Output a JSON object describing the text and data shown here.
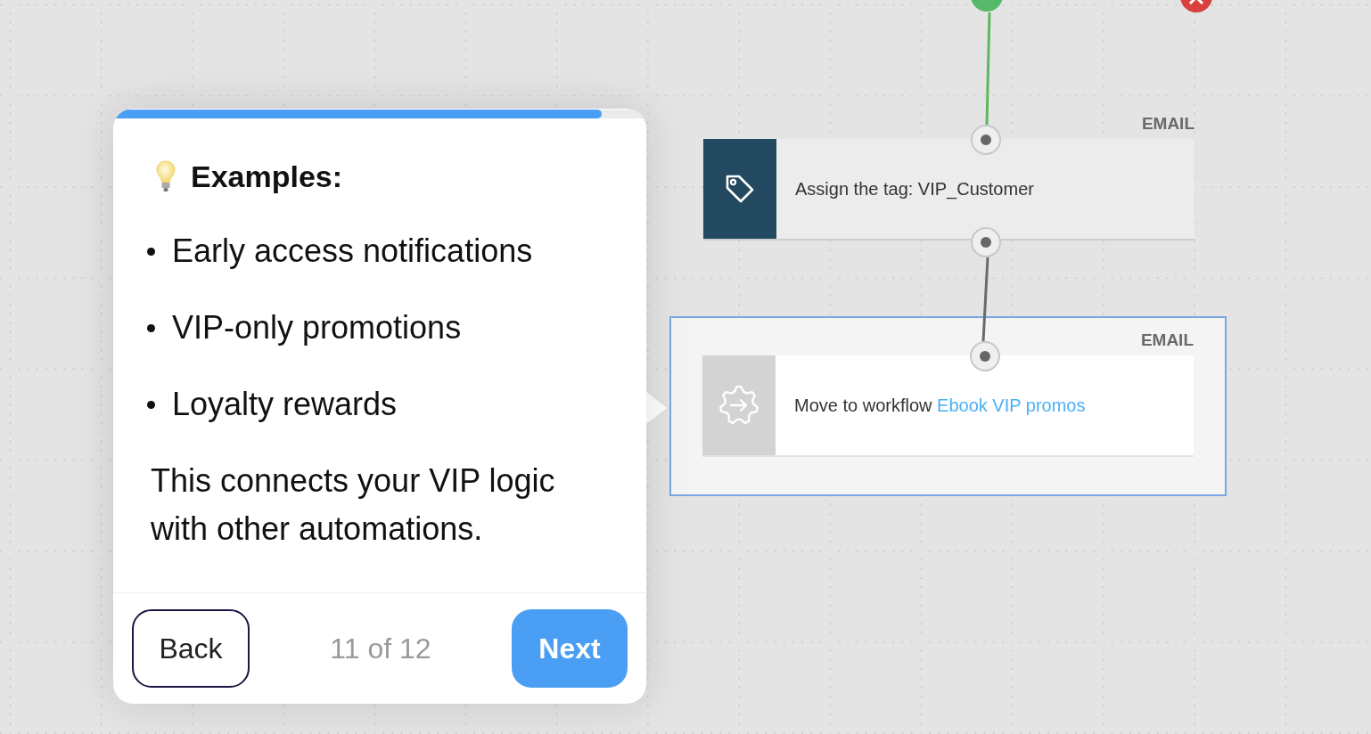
{
  "canvas": {
    "nodes": [
      {
        "kind": "tag",
        "badge": "EMAIL",
        "text": "Assign the tag: VIP_Customer",
        "selected": false
      },
      {
        "kind": "workflow",
        "badge": "EMAIL",
        "text": "Move to workflow",
        "link": "Ebook VIP promos",
        "selected": true
      }
    ]
  },
  "tour_popover": {
    "level": 0.92,
    "title": "Examples:",
    "bullets": [
      "Early access notifications",
      "VIP-only promotions",
      "Loyalty rewards"
    ],
    "body": "This connects your VIP logic with other automations.",
    "back_label": "Back",
    "step": "11 of 12",
    "next_label": "Next"
  }
}
